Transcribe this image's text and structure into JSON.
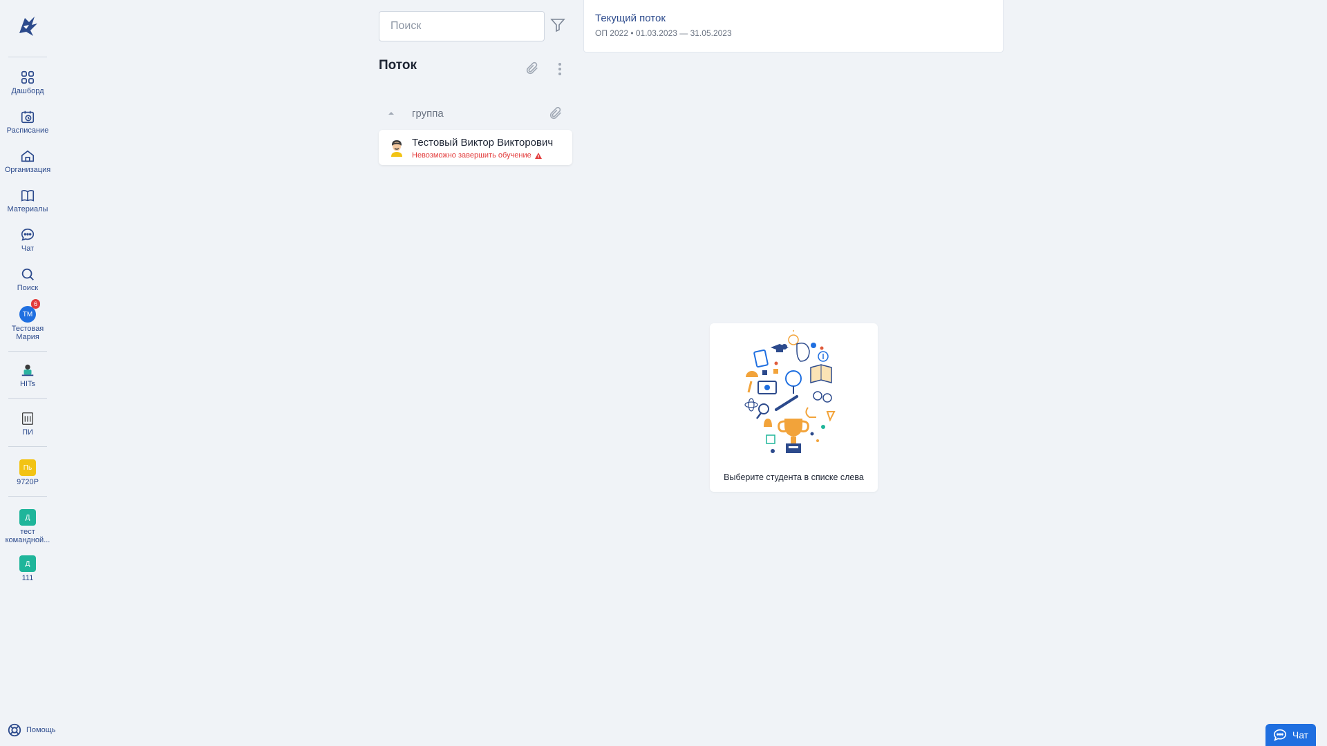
{
  "sidebar": {
    "nav": [
      {
        "label": "Дашборд",
        "icon": "dashboard-icon"
      },
      {
        "label": "Расписание",
        "icon": "schedule-icon"
      },
      {
        "label": "Организация",
        "icon": "organization-icon"
      },
      {
        "label": "Материалы",
        "icon": "materials-icon"
      },
      {
        "label": "Чат",
        "icon": "chat-icon"
      },
      {
        "label": "Поиск",
        "icon": "search-icon"
      }
    ],
    "profile": {
      "initials": "TM",
      "badge": "6",
      "label_line1": "Тестовая",
      "label_line2": "Мария"
    },
    "workspaces": [
      {
        "label": "HITs"
      },
      {
        "label": "ПИ"
      },
      {
        "label": "9720P",
        "initials": "Пь",
        "color": "#f2c314"
      },
      {
        "label_line1": "тест",
        "label_line2": "командной...",
        "initials": "Д",
        "color": "#1fb59a"
      },
      {
        "label": "111",
        "initials": "Д",
        "color": "#1fb59a"
      }
    ],
    "help": "Помощь"
  },
  "list_panel": {
    "search_placeholder": "Поиск",
    "title": "Поток",
    "group": "группа",
    "student": {
      "name": "Тестовый Виктор Викторович",
      "status": "Невозможно завершить обучение"
    }
  },
  "stream": {
    "title": "Текущий поток",
    "meta": "ОП 2022 • 01.03.2023 — 31.05.2023"
  },
  "empty_state": {
    "text": "Выберите студента в списке слева"
  },
  "chat_button": {
    "label": "Чат"
  },
  "colors": {
    "accent": "#2c4a8c",
    "brand_blue": "#1f6fe0",
    "error": "#e23b3b",
    "background": "#f0f3f7"
  }
}
